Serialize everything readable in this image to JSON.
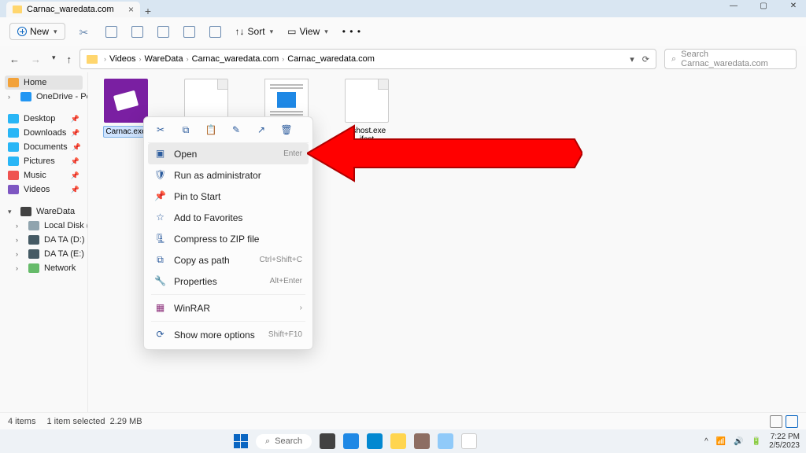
{
  "tab": {
    "title": "Carnac_waredata.com"
  },
  "toolbar": {
    "new": "New",
    "sort": "Sort",
    "view": "View"
  },
  "breadcrumb": [
    "Videos",
    "WareData",
    "Carnac_waredata.com",
    "Carnac_waredata.com"
  ],
  "search": {
    "placeholder": "Search Carnac_waredata.com"
  },
  "sidebar": {
    "home": "Home",
    "onedrive": "OneDrive - Persona",
    "quick": [
      "Desktop",
      "Downloads",
      "Documents",
      "Pictures",
      "Music",
      "Videos"
    ],
    "drives_header": "WareData",
    "drives": [
      "Local Disk (C:)",
      "DA TA (D:)",
      "DA TA (E:)",
      "Network"
    ]
  },
  "files": [
    {
      "name": "Carnac.exe",
      "type": "purple",
      "selected": true
    },
    {
      "name": "",
      "type": "blank"
    },
    {
      "name": "",
      "type": "doc"
    },
    {
      "name": "ushost.exe\nifest",
      "type": "blank"
    }
  ],
  "ctx": {
    "open": "Open",
    "open_sc": "Enter",
    "runas": "Run as administrator",
    "pin": "Pin to Start",
    "fav": "Add to Favorites",
    "zip": "Compress to ZIP file",
    "copypath": "Copy as path",
    "copypath_sc": "Ctrl+Shift+C",
    "props": "Properties",
    "props_sc": "Alt+Enter",
    "winrar": "WinRAR",
    "more": "Show more options",
    "more_sc": "Shift+F10"
  },
  "status": {
    "count": "4 items",
    "sel": "1 item selected",
    "size": "2.29 MB"
  },
  "taskbar": {
    "search": "Search",
    "time": "7:22 PM",
    "date": "2/5/2023"
  }
}
